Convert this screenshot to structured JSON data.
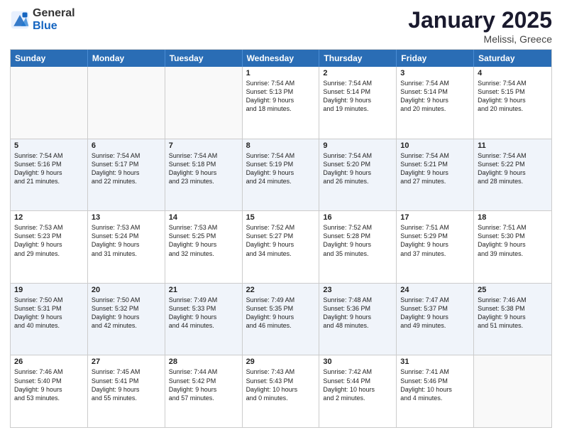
{
  "logo": {
    "general": "General",
    "blue": "Blue"
  },
  "title": "January 2025",
  "subtitle": "Melissi, Greece",
  "header_days": [
    "Sunday",
    "Monday",
    "Tuesday",
    "Wednesday",
    "Thursday",
    "Friday",
    "Saturday"
  ],
  "weeks": [
    [
      {
        "day": "",
        "lines": [],
        "empty": true
      },
      {
        "day": "",
        "lines": [],
        "empty": true
      },
      {
        "day": "",
        "lines": [],
        "empty": true
      },
      {
        "day": "1",
        "lines": [
          "Sunrise: 7:54 AM",
          "Sunset: 5:13 PM",
          "Daylight: 9 hours",
          "and 18 minutes."
        ]
      },
      {
        "day": "2",
        "lines": [
          "Sunrise: 7:54 AM",
          "Sunset: 5:14 PM",
          "Daylight: 9 hours",
          "and 19 minutes."
        ]
      },
      {
        "day": "3",
        "lines": [
          "Sunrise: 7:54 AM",
          "Sunset: 5:14 PM",
          "Daylight: 9 hours",
          "and 20 minutes."
        ]
      },
      {
        "day": "4",
        "lines": [
          "Sunrise: 7:54 AM",
          "Sunset: 5:15 PM",
          "Daylight: 9 hours",
          "and 20 minutes."
        ]
      }
    ],
    [
      {
        "day": "5",
        "lines": [
          "Sunrise: 7:54 AM",
          "Sunset: 5:16 PM",
          "Daylight: 9 hours",
          "and 21 minutes."
        ]
      },
      {
        "day": "6",
        "lines": [
          "Sunrise: 7:54 AM",
          "Sunset: 5:17 PM",
          "Daylight: 9 hours",
          "and 22 minutes."
        ]
      },
      {
        "day": "7",
        "lines": [
          "Sunrise: 7:54 AM",
          "Sunset: 5:18 PM",
          "Daylight: 9 hours",
          "and 23 minutes."
        ]
      },
      {
        "day": "8",
        "lines": [
          "Sunrise: 7:54 AM",
          "Sunset: 5:19 PM",
          "Daylight: 9 hours",
          "and 24 minutes."
        ]
      },
      {
        "day": "9",
        "lines": [
          "Sunrise: 7:54 AM",
          "Sunset: 5:20 PM",
          "Daylight: 9 hours",
          "and 26 minutes."
        ]
      },
      {
        "day": "10",
        "lines": [
          "Sunrise: 7:54 AM",
          "Sunset: 5:21 PM",
          "Daylight: 9 hours",
          "and 27 minutes."
        ]
      },
      {
        "day": "11",
        "lines": [
          "Sunrise: 7:54 AM",
          "Sunset: 5:22 PM",
          "Daylight: 9 hours",
          "and 28 minutes."
        ]
      }
    ],
    [
      {
        "day": "12",
        "lines": [
          "Sunrise: 7:53 AM",
          "Sunset: 5:23 PM",
          "Daylight: 9 hours",
          "and 29 minutes."
        ]
      },
      {
        "day": "13",
        "lines": [
          "Sunrise: 7:53 AM",
          "Sunset: 5:24 PM",
          "Daylight: 9 hours",
          "and 31 minutes."
        ]
      },
      {
        "day": "14",
        "lines": [
          "Sunrise: 7:53 AM",
          "Sunset: 5:25 PM",
          "Daylight: 9 hours",
          "and 32 minutes."
        ]
      },
      {
        "day": "15",
        "lines": [
          "Sunrise: 7:52 AM",
          "Sunset: 5:27 PM",
          "Daylight: 9 hours",
          "and 34 minutes."
        ]
      },
      {
        "day": "16",
        "lines": [
          "Sunrise: 7:52 AM",
          "Sunset: 5:28 PM",
          "Daylight: 9 hours",
          "and 35 minutes."
        ]
      },
      {
        "day": "17",
        "lines": [
          "Sunrise: 7:51 AM",
          "Sunset: 5:29 PM",
          "Daylight: 9 hours",
          "and 37 minutes."
        ]
      },
      {
        "day": "18",
        "lines": [
          "Sunrise: 7:51 AM",
          "Sunset: 5:30 PM",
          "Daylight: 9 hours",
          "and 39 minutes."
        ]
      }
    ],
    [
      {
        "day": "19",
        "lines": [
          "Sunrise: 7:50 AM",
          "Sunset: 5:31 PM",
          "Daylight: 9 hours",
          "and 40 minutes."
        ]
      },
      {
        "day": "20",
        "lines": [
          "Sunrise: 7:50 AM",
          "Sunset: 5:32 PM",
          "Daylight: 9 hours",
          "and 42 minutes."
        ]
      },
      {
        "day": "21",
        "lines": [
          "Sunrise: 7:49 AM",
          "Sunset: 5:33 PM",
          "Daylight: 9 hours",
          "and 44 minutes."
        ]
      },
      {
        "day": "22",
        "lines": [
          "Sunrise: 7:49 AM",
          "Sunset: 5:35 PM",
          "Daylight: 9 hours",
          "and 46 minutes."
        ]
      },
      {
        "day": "23",
        "lines": [
          "Sunrise: 7:48 AM",
          "Sunset: 5:36 PM",
          "Daylight: 9 hours",
          "and 48 minutes."
        ]
      },
      {
        "day": "24",
        "lines": [
          "Sunrise: 7:47 AM",
          "Sunset: 5:37 PM",
          "Daylight: 9 hours",
          "and 49 minutes."
        ]
      },
      {
        "day": "25",
        "lines": [
          "Sunrise: 7:46 AM",
          "Sunset: 5:38 PM",
          "Daylight: 9 hours",
          "and 51 minutes."
        ]
      }
    ],
    [
      {
        "day": "26",
        "lines": [
          "Sunrise: 7:46 AM",
          "Sunset: 5:40 PM",
          "Daylight: 9 hours",
          "and 53 minutes."
        ]
      },
      {
        "day": "27",
        "lines": [
          "Sunrise: 7:45 AM",
          "Sunset: 5:41 PM",
          "Daylight: 9 hours",
          "and 55 minutes."
        ]
      },
      {
        "day": "28",
        "lines": [
          "Sunrise: 7:44 AM",
          "Sunset: 5:42 PM",
          "Daylight: 9 hours",
          "and 57 minutes."
        ]
      },
      {
        "day": "29",
        "lines": [
          "Sunrise: 7:43 AM",
          "Sunset: 5:43 PM",
          "Daylight: 10 hours",
          "and 0 minutes."
        ]
      },
      {
        "day": "30",
        "lines": [
          "Sunrise: 7:42 AM",
          "Sunset: 5:44 PM",
          "Daylight: 10 hours",
          "and 2 minutes."
        ]
      },
      {
        "day": "31",
        "lines": [
          "Sunrise: 7:41 AM",
          "Sunset: 5:46 PM",
          "Daylight: 10 hours",
          "and 4 minutes."
        ]
      },
      {
        "day": "",
        "lines": [],
        "empty": true
      }
    ]
  ]
}
